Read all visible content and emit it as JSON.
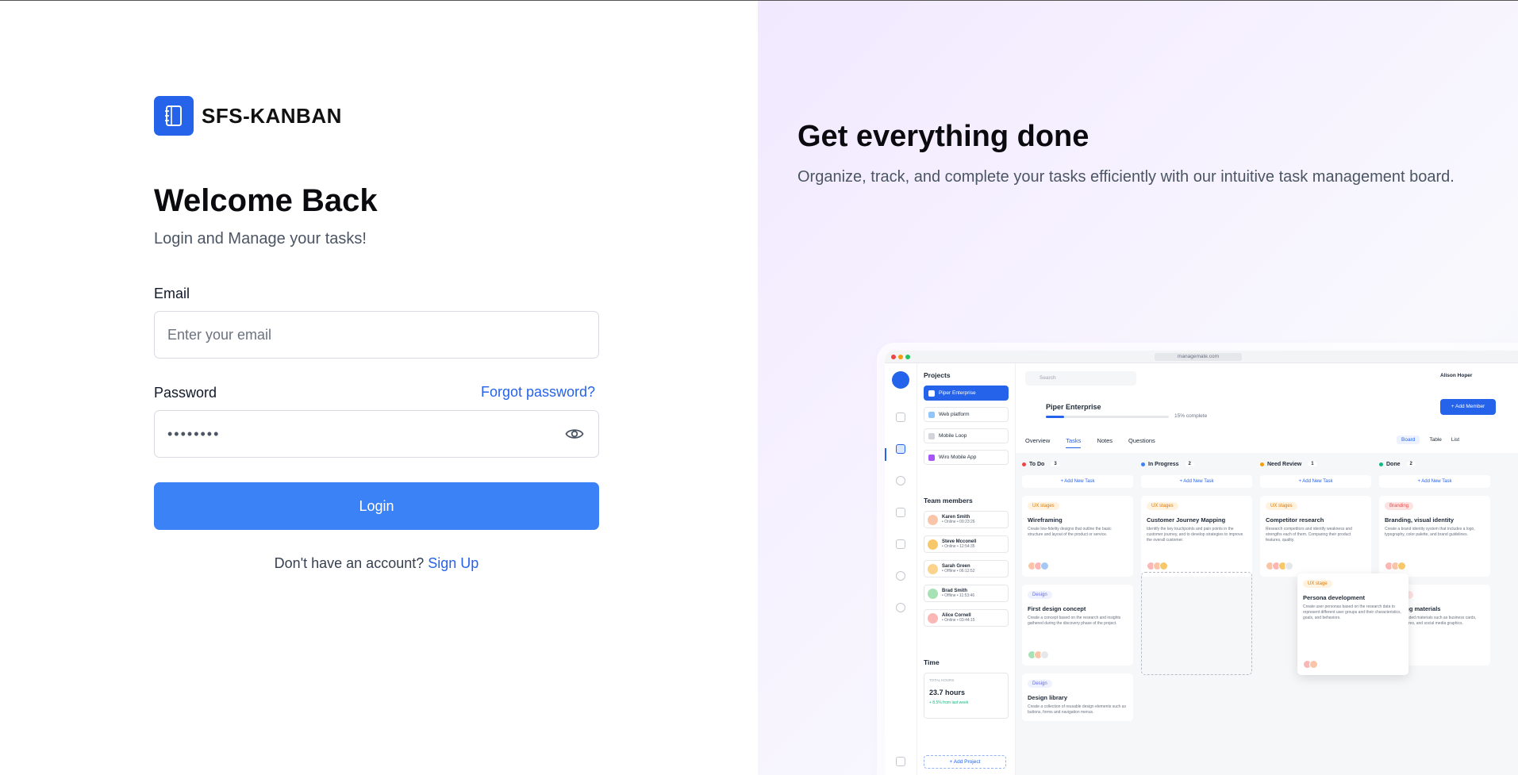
{
  "brand": {
    "name": "SFS-KANBAN",
    "logo_icon": "notebook-icon",
    "color": "#2563eb"
  },
  "login": {
    "title": "Welcome Back",
    "subtitle": "Login and Manage your tasks!",
    "email_label": "Email",
    "email_placeholder": "Enter your email",
    "password_label": "Password",
    "password_value": "••••••••",
    "forgot_label": "Forgot password?",
    "button_label": "Login",
    "signup_prompt": "Don't have an account?",
    "signup_link": "Sign Up",
    "accent_color": "#3b82f6"
  },
  "promo": {
    "title": "Get everything done",
    "subtitle": "Organize, track, and complete your tasks efficiently with our intuitive task management board."
  },
  "mock": {
    "url": "managemate.com",
    "projects_heading": "Projects",
    "projects": [
      {
        "label": "Piper Enterprise",
        "color": "#ffffff"
      },
      {
        "label": "Web platform",
        "color": "#93c5fd"
      },
      {
        "label": "Mobile Loop",
        "color": "#d1d5db"
      },
      {
        "label": "Wiro Mobile App",
        "color": "#a855f7"
      }
    ],
    "team_heading": "Team members",
    "members": [
      {
        "name": "Karen Smith",
        "status": "• Online • 09:23:26",
        "color": "#f9c5a8"
      },
      {
        "name": "Steve Mcconell",
        "status": "• Online • 12:54:35",
        "color": "#f6c86a"
      },
      {
        "name": "Sarah Green",
        "status": "• Offline • 06:12:52",
        "color": "#fbd38d"
      },
      {
        "name": "Brad Smith",
        "status": "• Offline • 11:53:46",
        "color": "#a7e1b6"
      },
      {
        "name": "Alice Cornell",
        "status": "• Online • 03:44:15",
        "color": "#fbb6b6"
      }
    ],
    "time_heading": "Time",
    "time_caption": "TOTAL HOURS",
    "time_value": "23.7 hours",
    "time_delta": "+ 8.5% from last week",
    "add_project": "+ Add Project",
    "search_placeholder": "Search",
    "user_name": "Alison Hoper",
    "project_title": "Piper Enterprise",
    "progress_pct": 15,
    "progress_label": "15% complete",
    "add_member": "+ Add Member",
    "tabs": [
      "Overview",
      "Tasks",
      "Notes",
      "Questions"
    ],
    "views": [
      "Board",
      "Table",
      "List"
    ],
    "columns": [
      {
        "name": "To Do",
        "count": "3",
        "color": "#ef4444"
      },
      {
        "name": "In Progress",
        "count": "2",
        "color": "#3b82f6"
      },
      {
        "name": "Need Review",
        "count": "1",
        "color": "#f59e0b"
      },
      {
        "name": "Done",
        "count": "2",
        "color": "#10b981"
      }
    ],
    "add_task": "+ Add New Task",
    "cards": {
      "todo": [
        {
          "tag": "UX stages",
          "tag_bg": "#fff3e0",
          "tag_fg": "#d97706",
          "title": "Wireframing",
          "desc": "Create low-fidelity designs that outline the basic structure and layout of the product or service."
        },
        {
          "tag": "Design",
          "tag_bg": "#eef2ff",
          "tag_fg": "#6366f1",
          "title": "First design concept",
          "desc": "Create a concept based on the research and insights gathered during the discovery phase of the project."
        },
        {
          "tag": "Design",
          "tag_bg": "#eef2ff",
          "tag_fg": "#6366f1",
          "title": "Design library",
          "desc": "Create a collection of reusable design elements such as buttons, forms and navigation menus."
        }
      ],
      "progress": [
        {
          "tag": "UX stages",
          "tag_bg": "#fff3e0",
          "tag_fg": "#d97706",
          "title": "Customer Journey Mapping",
          "desc": "Identify the key touchpoints and pain points in the customer journey, and to develop strategies to improve the overall customer."
        }
      ],
      "review": [
        {
          "tag": "UX stages",
          "tag_bg": "#fff3e0",
          "tag_fg": "#d97706",
          "title": "Competitor research",
          "desc": "Research competitors and identify weakness and strengths each of them. Comparing their product features, quality."
        }
      ],
      "done": [
        {
          "tag": "Branding",
          "tag_bg": "#fde2e2",
          "tag_fg": "#ef4444",
          "title": "Branding, visual identity",
          "desc": "Create a brand identity system that includes a logo, typography, color palette, and brand guidelines."
        },
        {
          "tag": "Branding",
          "tag_bg": "#fde2e2",
          "tag_fg": "#ef4444",
          "title": "Marketing materials",
          "desc": "Create a branded materials such as business cards, flyers, brochures, and social media graphics."
        }
      ],
      "floating": {
        "tag": "UX stage",
        "tag_bg": "#fff3e0",
        "tag_fg": "#d97706",
        "title": "Persona development",
        "desc": "Create user personas based on the research data to represent different user groups and their characteristics, goals, and behaviors."
      }
    }
  }
}
